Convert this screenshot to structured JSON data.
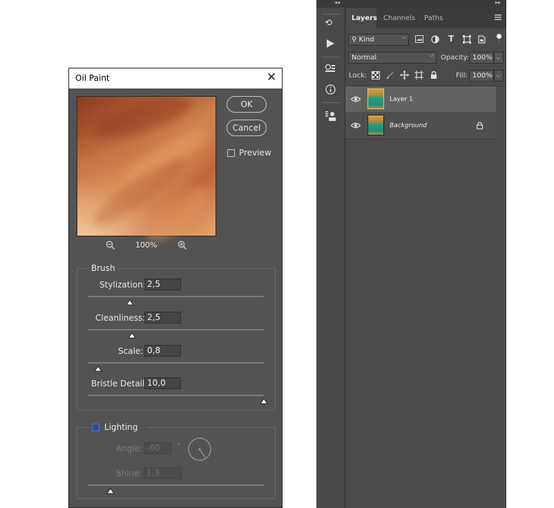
{
  "dialog": {
    "title": "Oil Paint",
    "close_glyph": "✕",
    "ok_label": "OK",
    "cancel_label": "Cancel",
    "preview_label": "Preview",
    "zoom": "100%",
    "zoom_out_icon": "zoom-out-icon",
    "zoom_in_icon": "zoom-in-icon",
    "brush": {
      "title": "Brush",
      "params": [
        {
          "label": "Stylization:",
          "value": "2,5",
          "level": 0.24
        },
        {
          "label": "Cleanliness:",
          "value": "2,5",
          "level": 0.25
        },
        {
          "label": "Scale:",
          "value": "0,8",
          "level": 0.06
        },
        {
          "label": "Bristle Detail:",
          "value": "10,0",
          "level": 1.0
        }
      ]
    },
    "lighting": {
      "title": "Lighting",
      "angle_label": "Angle:",
      "angle_value": "-60",
      "degree": "°",
      "shine_label": "Shine:",
      "shine_value": "1,3",
      "shine_level": 0.13
    }
  },
  "panel": {
    "collapse_left": "◂◂",
    "collapse_right": "▸▸",
    "tabs": [
      "Layers",
      "Channels",
      "Paths"
    ],
    "menu_icon": "hamburger-menu-icon",
    "filter_kind": "Kind",
    "blend_mode": "Normal",
    "opacity_label": "Opacity:",
    "opacity_value": "100%",
    "lock_label": "Lock:",
    "fill_label": "Fill:",
    "fill_value": "100%",
    "layers": [
      {
        "name": "Layer 1",
        "visible": true,
        "selected": true,
        "locked": false
      },
      {
        "name": "Background",
        "visible": true,
        "selected": false,
        "locked": true
      }
    ]
  },
  "colors": {
    "dialog_bg": "#535353",
    "panel_bg": "#4a4a4a",
    "selected_row": "#636363",
    "lighting_checkbox": "#2b4f9b"
  }
}
